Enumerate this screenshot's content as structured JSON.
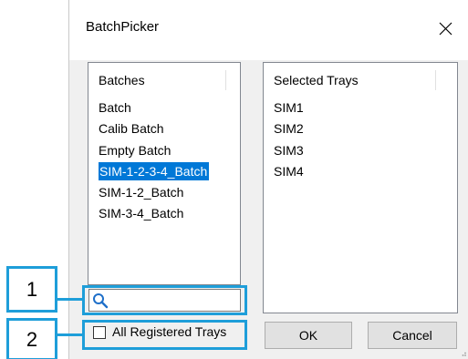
{
  "window": {
    "title": "BatchPicker"
  },
  "batches_list": {
    "header": "Batches",
    "items": [
      "Batch",
      "Calib Batch",
      "Empty Batch",
      "SIM-1-2-3-4_Batch",
      "SIM-1-2_Batch",
      "SIM-3-4_Batch"
    ],
    "selected": "SIM-1-2-3-4_Batch"
  },
  "trays_list": {
    "header": "Selected Trays",
    "items": [
      "SIM1",
      "SIM2",
      "SIM3",
      "SIM4"
    ]
  },
  "search": {
    "value": "",
    "icon": "search-icon"
  },
  "checkbox": {
    "label": "All Registered Trays",
    "checked": false
  },
  "buttons": {
    "ok": "OK",
    "cancel": "Cancel"
  },
  "callouts": [
    "1",
    "2"
  ],
  "colors": {
    "accent": "#1e9ed9",
    "selection": "#0078d7"
  }
}
